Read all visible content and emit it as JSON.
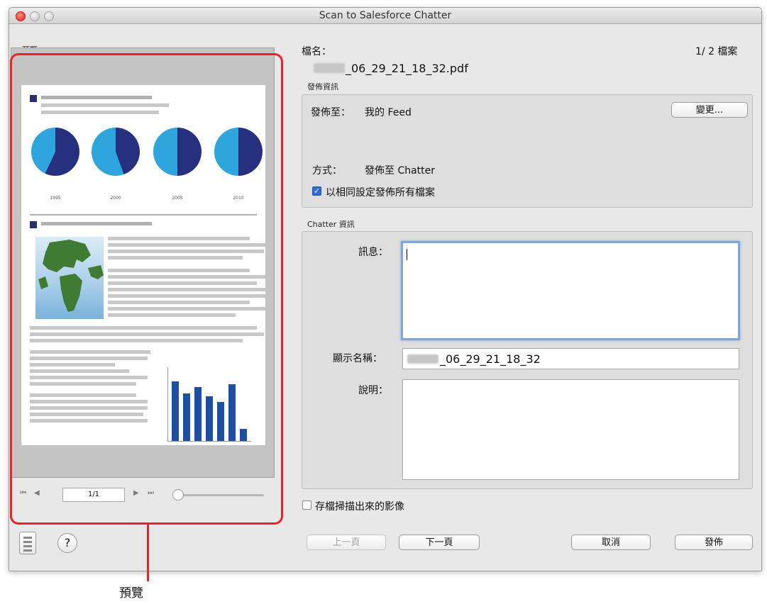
{
  "window": {
    "title": "Scan to Salesforce Chatter"
  },
  "preview": {
    "label": "預覽",
    "callout": "預覽",
    "page_indicator": "1/1",
    "years": [
      "1995",
      "2000",
      "2005",
      "2010"
    ],
    "bar_values": [
      100,
      80,
      90,
      75,
      65,
      95,
      20
    ]
  },
  "file": {
    "name_label": "檔名：",
    "filename": "_06_29_21_18_32.pdf",
    "count": "1/  2 檔案"
  },
  "post_info": {
    "section_label": "發佈資訊",
    "post_to_label": "發佈至：",
    "post_to_value": "我的 Feed",
    "change_button": "變更...",
    "method_label": "方式：",
    "method_value": "發佈至 Chatter",
    "same_settings_label": "以相同設定發佈所有檔案",
    "same_settings_checked": true
  },
  "chatter_info": {
    "section_label": "Chatter 資訊",
    "message_label": "訊息：",
    "message_value": "",
    "display_name_label": "顯示名稱：",
    "display_name_value": "_06_29_21_18_32",
    "description_label": "說明：",
    "description_value": ""
  },
  "save_scanned_label": "存檔掃描出來的影像",
  "buttons": {
    "prev": "上一頁",
    "next": "下一頁",
    "cancel": "取消",
    "post": "發佈"
  },
  "colors": {
    "accent_red": "#e8242a",
    "pie_dark": "#27307e",
    "pie_light": "#2ea6dd",
    "bar_blue": "#1d4fa0"
  }
}
